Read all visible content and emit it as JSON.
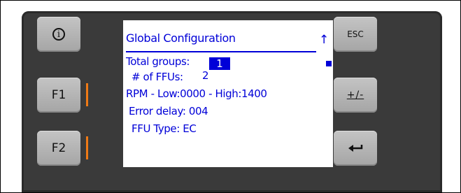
{
  "buttons": {
    "info_symbol": "i",
    "f1_label": "F1",
    "f2_label": "F2",
    "esc_label": "ESC",
    "plusminus_label": "+/-",
    "enter_symbol": "←"
  },
  "screen": {
    "title": "Global Configuration",
    "scroll_up_symbol": "↑",
    "total_groups_label": "Total groups:",
    "total_groups_value": "1",
    "ffus_label": "# of FFUs:",
    "ffus_value": "2",
    "rpm_line": "RPM - Low:0000 - High:1400",
    "error_delay_line": "Error delay: 004",
    "ffu_type_line": "FFU Type: EC"
  },
  "colors": {
    "display_text": "#0000d8",
    "panel": "#3a3a3a",
    "button": "#b4b4b4",
    "accent_bar": "#f07a15"
  }
}
